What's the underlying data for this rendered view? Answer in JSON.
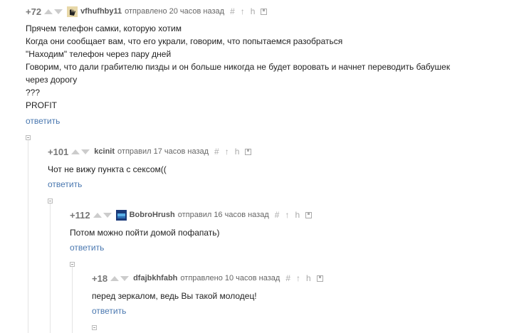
{
  "comments": [
    {
      "rating": "+72",
      "author": "vfhufhby11",
      "sent": "отправлено 20 часов назад",
      "lines": [
        "Прячем телефон самки, которую хотим",
        "Когда они сообщает вам, что его украли, говорим, что попытаемся разобраться",
        "\"Находим\" телефон через пару дней",
        "Говорим, что дали грабителю пизды и он больше никогда не будет воровать и начнет переводить бабушек",
        "через дорогу",
        "???",
        "PROFIT"
      ],
      "reply": "ответить"
    },
    {
      "rating": "+101",
      "author": "kcinit",
      "sent": "отправил 17 часов назад",
      "lines": [
        "Чот не вижу пункта с сексом(("
      ],
      "reply": "ответить"
    },
    {
      "rating": "+112",
      "author": "BobroHrush",
      "sent": "отправил 16 часов назад",
      "lines": [
        "Потом можно пойти домой пофапать)"
      ],
      "reply": "ответить"
    },
    {
      "rating": "+18",
      "author": "dfajbkhfabh",
      "sent": "отправлено 10 часов назад",
      "lines": [
        "перед зеркалом, ведь Вы такой молодец!"
      ],
      "reply": "ответить"
    }
  ],
  "tools": {
    "hash": "#",
    "up": "↑",
    "h": "h"
  }
}
